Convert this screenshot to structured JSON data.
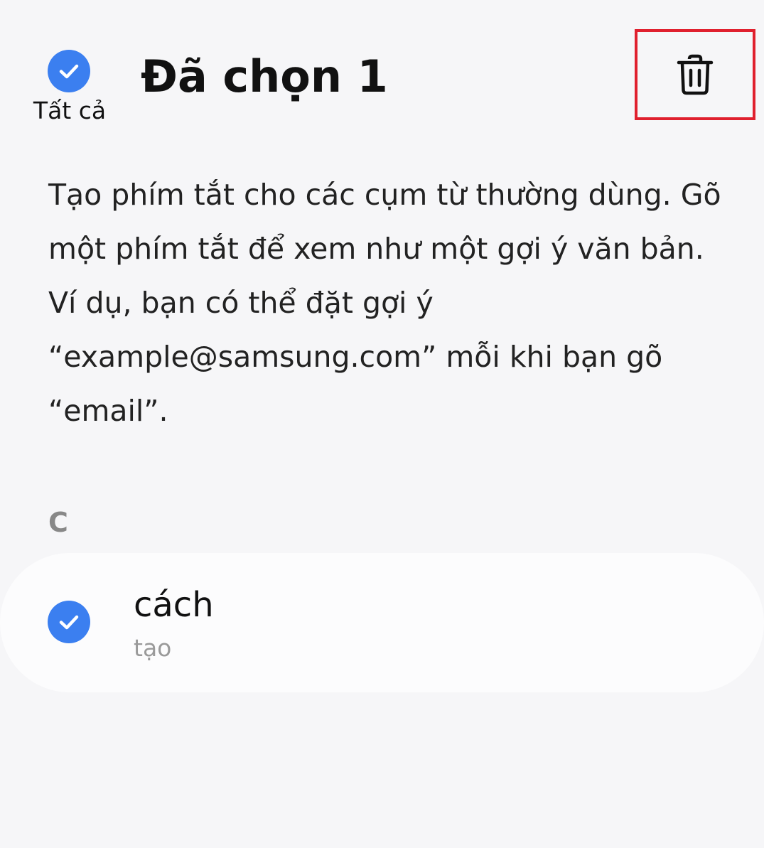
{
  "header": {
    "select_all_label": "Tất cả",
    "title": "Đã chọn 1",
    "delete_icon": "trash-icon"
  },
  "description": "Tạo phím tắt cho các cụm từ thường dùng. Gõ một phím tắt để xem như một gợi ý văn bản. Ví dụ, bạn có thể đặt gợi ý “example@samsung.com” mỗi khi bạn gõ “email”.",
  "sections": [
    {
      "index_label": "C",
      "items": [
        {
          "title": "cách",
          "subtitle": "tạo",
          "checked": true
        }
      ]
    }
  ],
  "colors": {
    "accent": "#3b7ff0",
    "highlight_border": "#e0202e",
    "background": "#f6f6f8",
    "card": "#fcfcfd"
  }
}
